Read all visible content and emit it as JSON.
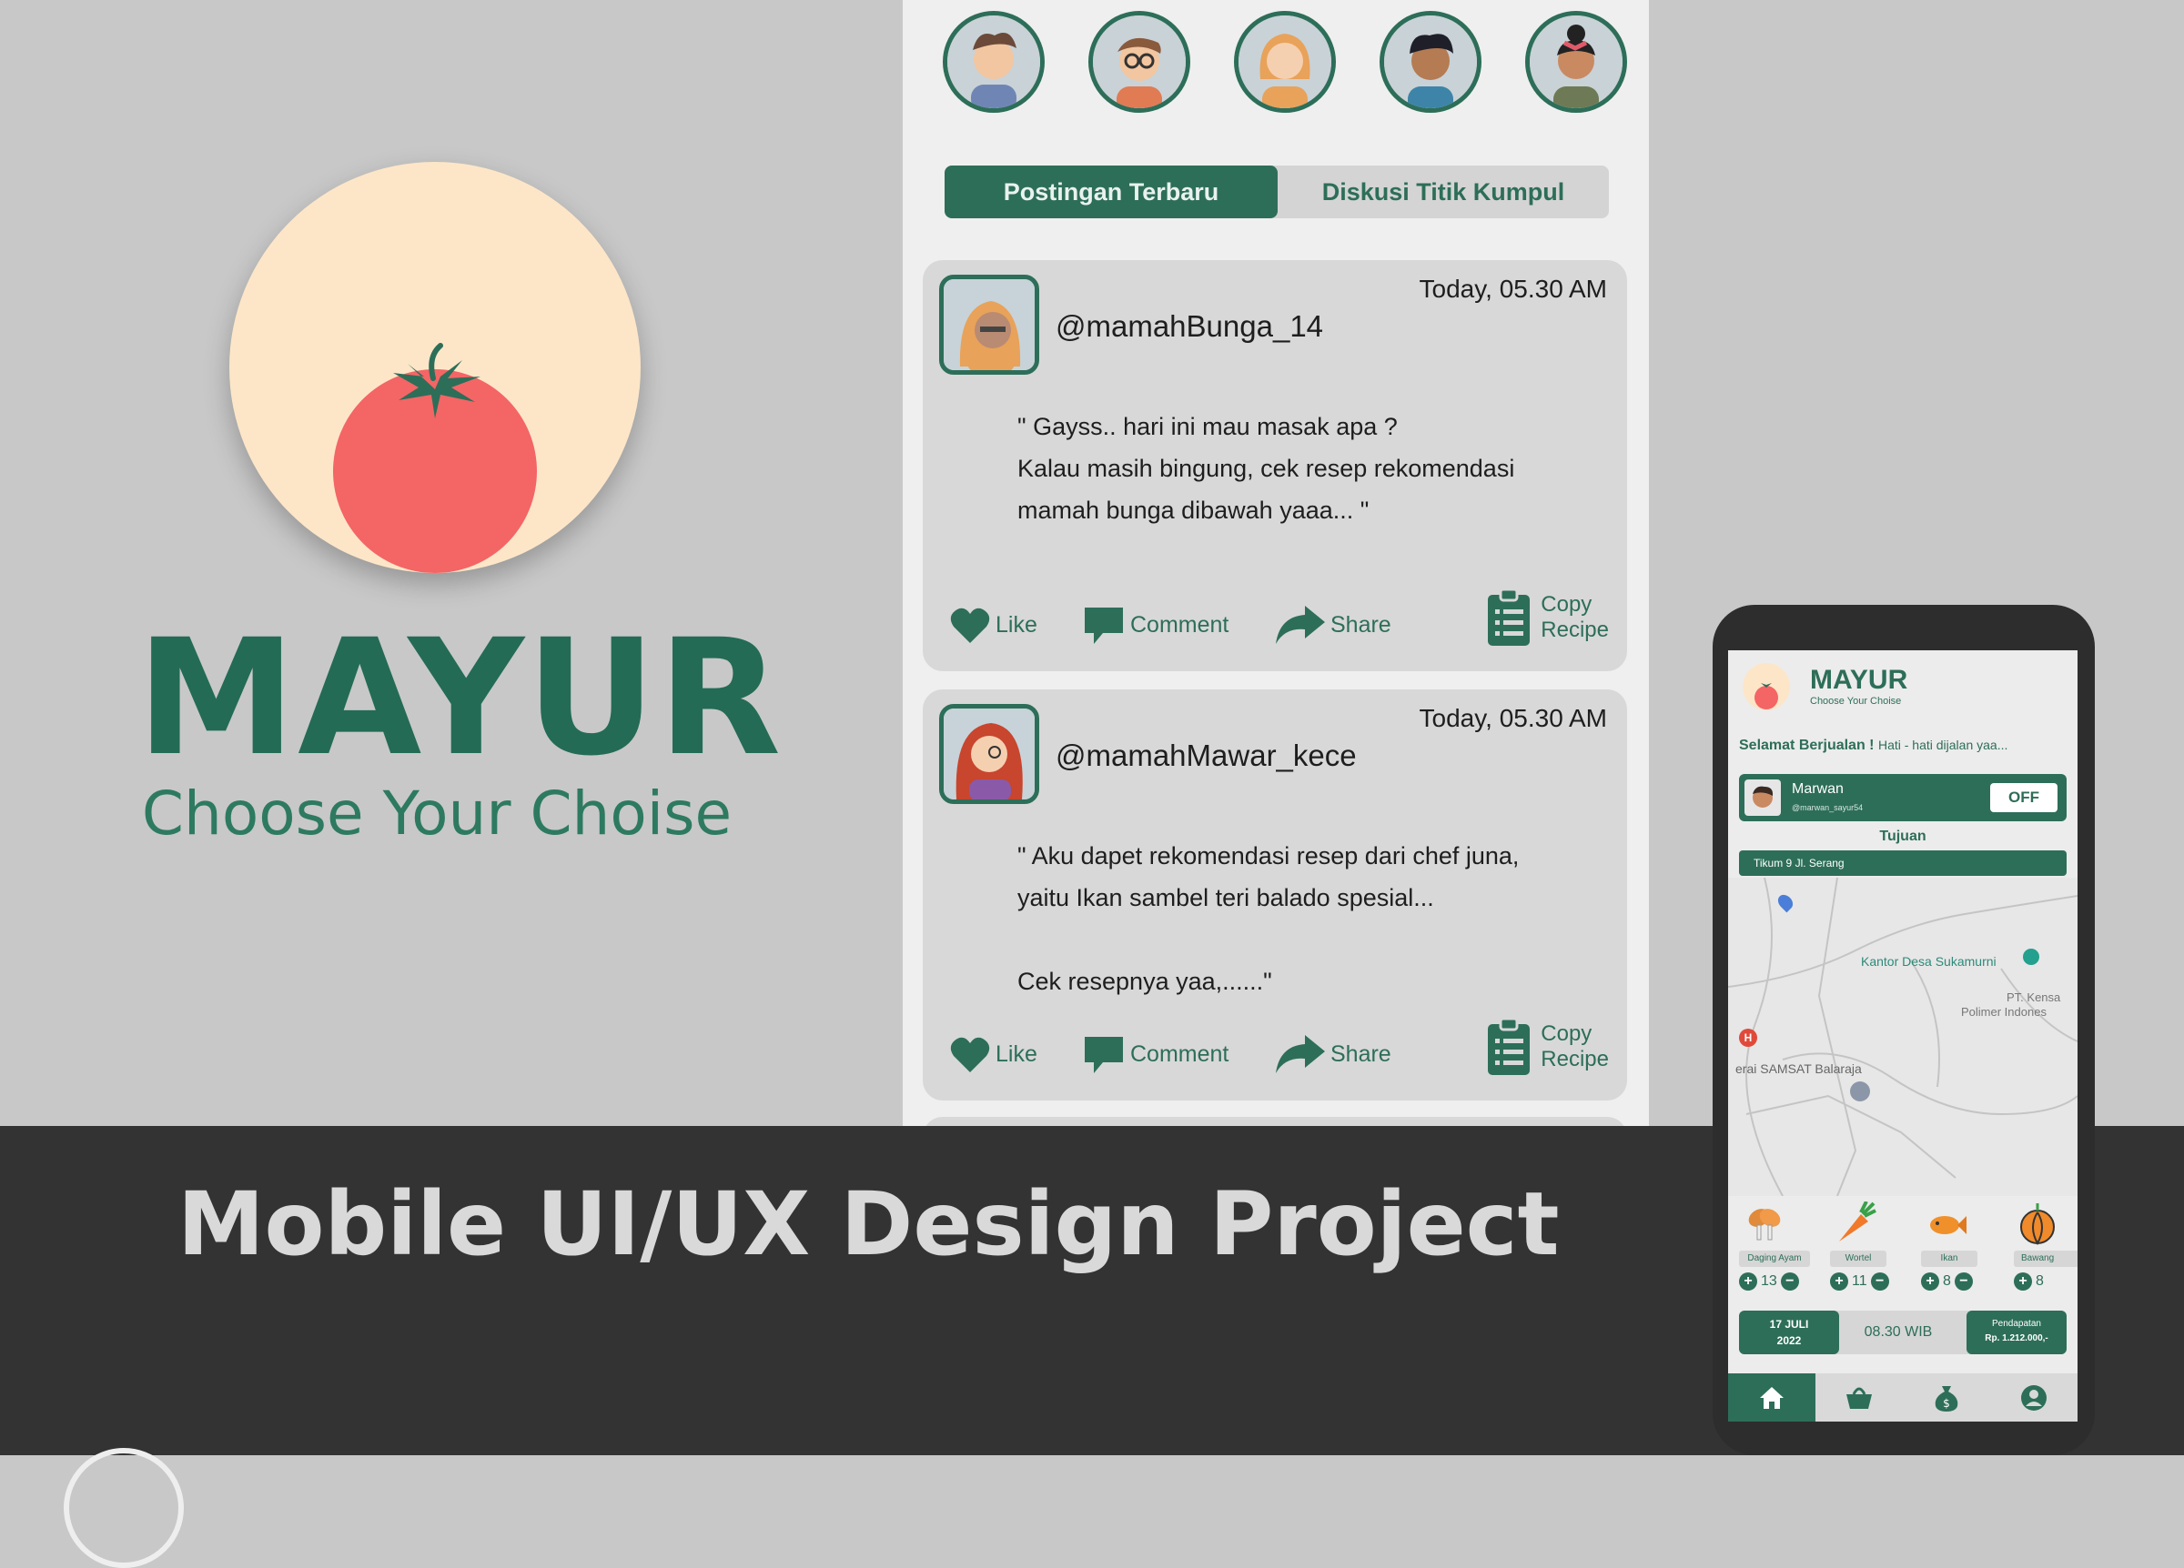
{
  "brand": {
    "title": "MAYUR",
    "tagline": "Choose Your Choise"
  },
  "footer": {
    "project_title": "Mobile UI/UX Design Project"
  },
  "feed": {
    "tabs": [
      {
        "label": "Postingan Terbaru",
        "active": true
      },
      {
        "label": "Diskusi Titik Kumpul",
        "active": false
      }
    ],
    "posts": [
      {
        "user": "@mamahBunga_14",
        "time": "Today, 05.30 AM",
        "body": "\" Gayss.. hari ini mau masak apa ?\nKalau masih bingung, cek resep rekomendasi\nmamah bunga dibawah yaaa... \"",
        "like": "Like",
        "comment": "Comment",
        "share": "Share",
        "copy_line1": "Copy",
        "copy_line2": "Recipe"
      },
      {
        "user": "@mamahMawar_kece",
        "time": "Today, 05.30 AM",
        "body": "\" Aku dapet rekomendasi resep dari chef juna,\nyaitu Ikan sambel teri balado spesial...\n\nCek resepnya yaa,......\"",
        "like": "Like",
        "comment": "Comment",
        "share": "Share",
        "copy_line1": "Copy",
        "copy_line2": "Recipe"
      }
    ]
  },
  "phone": {
    "app_title": "MAYUR",
    "app_tagline": "Choose Your Choise",
    "greeting_bold": "Selamat Berjualan !",
    "greeting_rest": "Hati - hati dijalan yaa...",
    "seller_name": "Marwan",
    "seller_handle": "@marwan_sayur54",
    "toggle_label": "OFF",
    "destination_label": "Tujuan",
    "destination_value": "Tikum 9 Jl. Serang",
    "map_labels": {
      "kantor": "Kantor Desa Sukamurni",
      "pt1": "PT. Kensa",
      "pt2": "Polimer Indones",
      "samsat": "erai SAMSAT Balaraja"
    },
    "products": [
      {
        "name": "Daging Ayam",
        "qty": "13"
      },
      {
        "name": "Wortel",
        "qty": "11"
      },
      {
        "name": "Ikan",
        "qty": "8"
      },
      {
        "name": "Bawang",
        "qty": "8"
      }
    ],
    "date_line1": "17 JULI",
    "date_line2": "2022",
    "time": "08.30 WIB",
    "income_label": "Pendapatan",
    "income_value": "Rp. 1.212.000,-"
  },
  "colors": {
    "primary": "#2d6e59",
    "logo_bg": "#fde6c8",
    "tomato": "#f46565",
    "footer_bg": "#333333",
    "page_bg": "#c8c8c8"
  }
}
